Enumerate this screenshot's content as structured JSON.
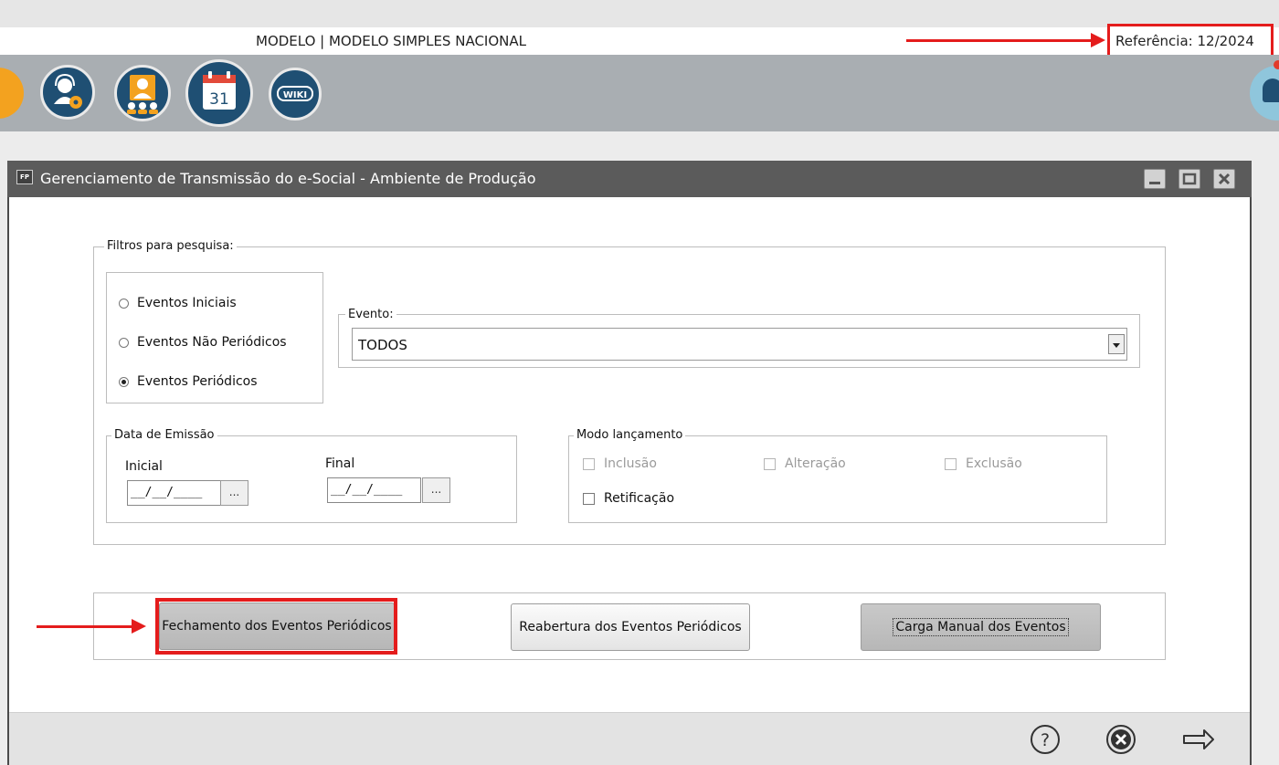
{
  "header": {
    "company": "MODELO | MODELO SIMPLES NACIONAL",
    "reference": "Referência: 12/2024"
  },
  "toolbar": {
    "icons": [
      "support-gear-icon",
      "users-icon",
      "calendar-icon",
      "wiki-icon"
    ],
    "calendar_day": "31",
    "wiki_label": "WIKI"
  },
  "window": {
    "title": "Gerenciamento de Transmissão do e-Social - Ambiente de Produção",
    "app_badge": "FP"
  },
  "filters": {
    "legend": "Filtros para pesquisa:",
    "radios": [
      {
        "label": "Eventos Iniciais",
        "checked": false
      },
      {
        "label": "Eventos Não Periódicos",
        "checked": false
      },
      {
        "label": "Eventos Periódicos",
        "checked": true
      }
    ],
    "event_legend": "Evento:",
    "event_value": "TODOS"
  },
  "emission": {
    "legend": "Data de Emissão",
    "initial_label": "Inicial",
    "final_label": "Final",
    "initial_value": "__/__/____",
    "final_value": "__/__/____",
    "picker_label": "..."
  },
  "mode": {
    "legend": "Modo lançamento",
    "inclusao": "Inclusão",
    "alteracao": "Alteração",
    "exclusao": "Exclusão",
    "retificacao": "Retificação"
  },
  "actions": {
    "close_periodic": "Fechamento dos Eventos Periódicos",
    "reopen_periodic": "Reabertura dos Eventos Periódicos",
    "manual_load": "Carga Manual dos Eventos"
  },
  "colors": {
    "highlight": "#e41c1c",
    "titlebar": "#5b5b5b",
    "toolbar": "#a9aeb2",
    "icon_bg": "#1f4f73"
  }
}
